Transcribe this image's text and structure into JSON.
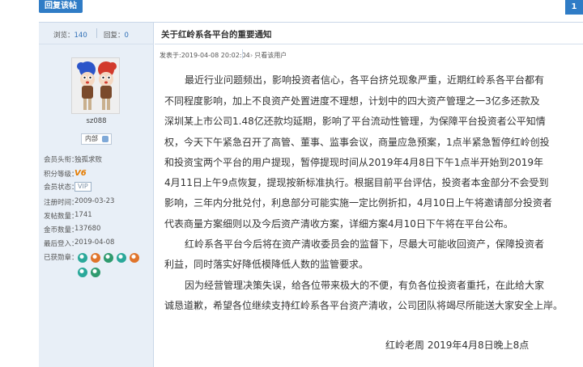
{
  "toolbar": {
    "reply_label": "回复该帖",
    "page_number": "1"
  },
  "post": {
    "stats": {
      "views_label": "浏览：",
      "views": "140",
      "replies_label": "回复：",
      "replies": "0"
    },
    "author": {
      "username": "sz088",
      "user_group": "内部",
      "info": [
        {
          "label": "会员头衔：",
          "value": "独孤求败"
        },
        {
          "label": "积分等级：",
          "value": "V6"
        },
        {
          "label": "会员状态：",
          "value": "VIP"
        },
        {
          "label": "注册时间：",
          "value": "2009-03-23"
        },
        {
          "label": "发帖数量：",
          "value": "1741"
        },
        {
          "label": "金币数量：",
          "value": "137680"
        },
        {
          "label": "最后登入：",
          "value": "2019-04-08"
        },
        {
          "label": "已获勋章：",
          "value": ""
        }
      ],
      "medal_colors": [
        "#2aa89a",
        "#e0742b",
        "#2f9a6e",
        "#2aa89a",
        "#e0742b",
        "#2aa89a",
        "#2f9a6e"
      ]
    },
    "title": "关于红岭系各平台的重要通知",
    "posted_at": "发表于:2019-04-08 20:02:04",
    "author_only_label": "只看该用户",
    "body_lines": [
      "最近行业问题频出，影响投资者信心，各平台挤兑现象严重，近期红岭系各平台都有",
      "不同程度影响，加上不良资产处置进度不理想，计划中的四大资产管理之一3亿多还款及",
      "深圳某上市公司1.48亿还款均延期，影响了平台流动性管理，为保障平台投资者公平知情",
      "权，今天下午紧急召开了高管、董事、监事会议，商量应急预案，1点半紧急暂停红岭创投",
      "和投资宝两个平台的用户提现，暂停提现时间从2019年4月8日下午1点半开始到2019年",
      "4月11日上午9点恢复，提现按新标准执行。根据目前平台评估，投资者本金部分不会受到",
      "影响，三年内分批兑付，利息部分可能实施一定比例折扣，4月10日上午将邀请部分投资者",
      "代表商量方案细则以及今后资产清收方案，详细方案4月10日下午将在平台公布。",
      "红岭系各平台今后将在资产清收委员会的监督下，尽最大可能收回资产，保障投资者",
      "利益，同时落实好降低模降低人数的监管要求。",
      "因为经营管理决策失误，给各位带来极大的不便，有负各位投资者重托，在此给大家",
      "诚恳道歉，希望各位继续支持红岭系各平台资产清收，公司团队将竭尽所能送大家安全上岸。",
      "红岭老周  2019年4月8日晚上8点"
    ]
  }
}
